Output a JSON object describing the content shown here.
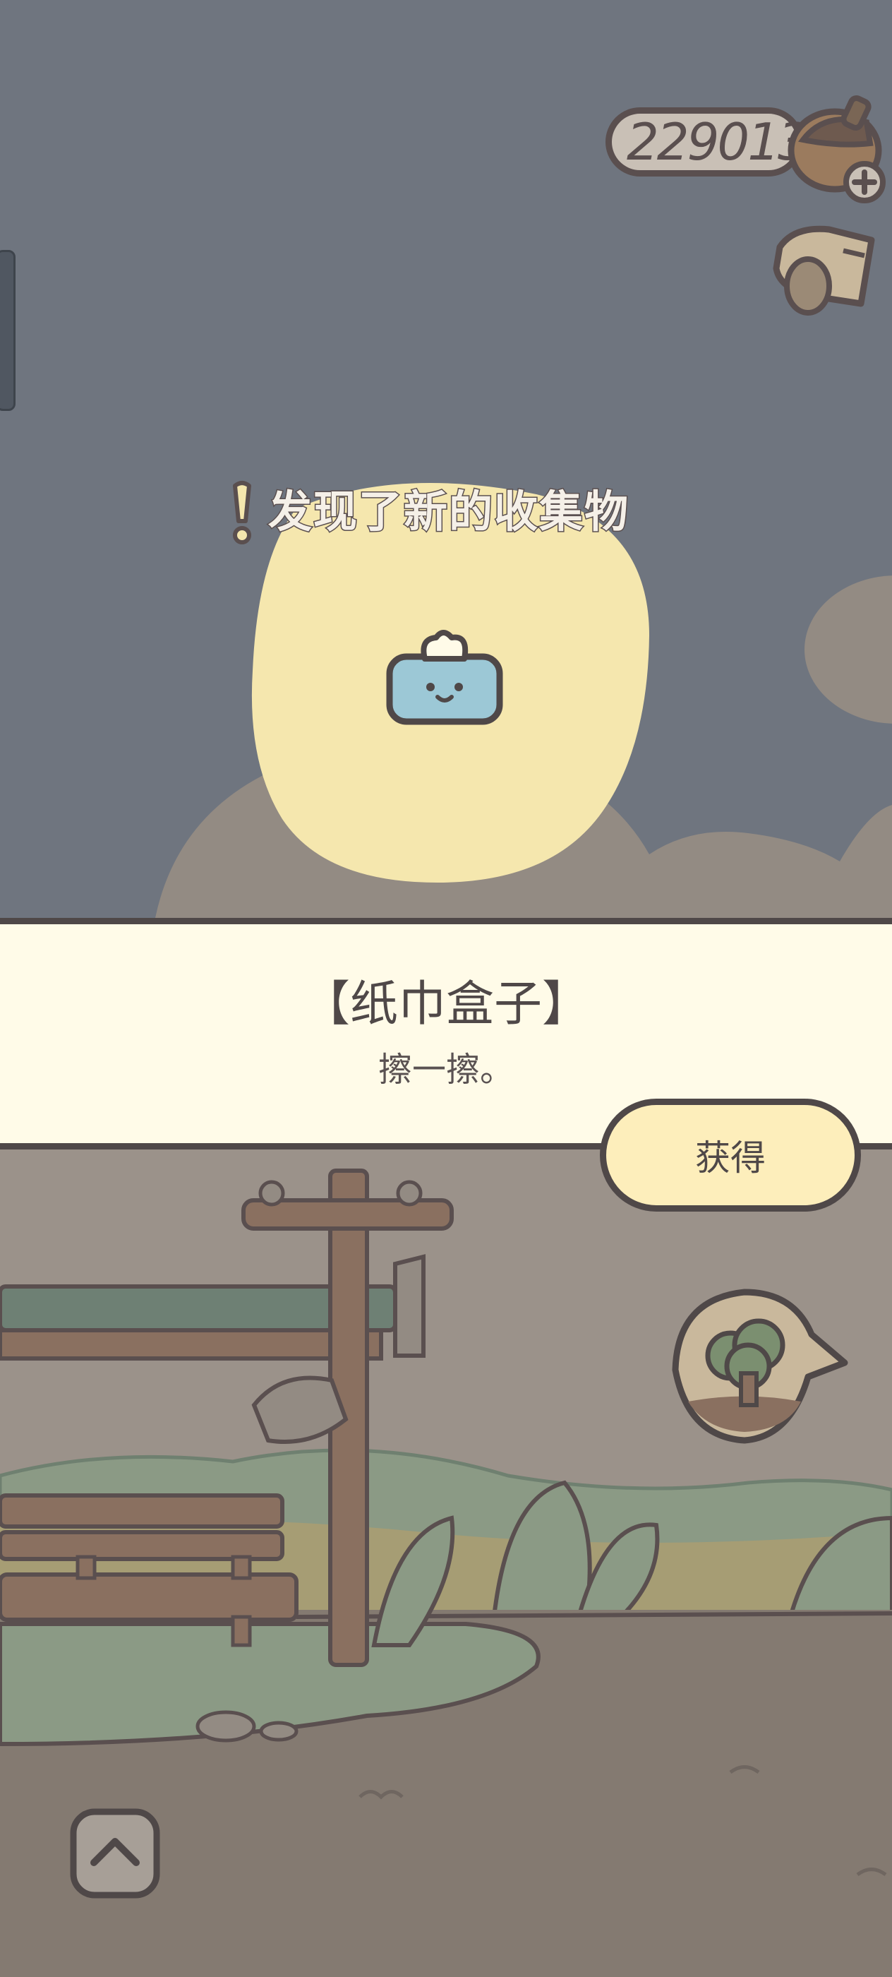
{
  "currency": {
    "amount": "229013",
    "icon": "acorn-icon",
    "add_icon": "plus-icon"
  },
  "mailbox": {
    "icon": "mailbox-icon"
  },
  "discovery": {
    "title": "发现了新的收集物",
    "alert_icon": "exclamation-icon"
  },
  "item": {
    "name": "【纸巾盒子】",
    "description": "擦一擦。",
    "icon": "tissue-box-icon"
  },
  "actions": {
    "obtain_label": "获得"
  },
  "map_bubble": {
    "icon": "tree-icon"
  },
  "nav": {
    "up_icon": "chevron-up-icon"
  },
  "colors": {
    "sky": "#6f757f",
    "ground": "#847a71",
    "glow": "#f5e7ae",
    "outline": "#4f4848",
    "band": "#fffbe8",
    "button": "#fdeebb"
  }
}
